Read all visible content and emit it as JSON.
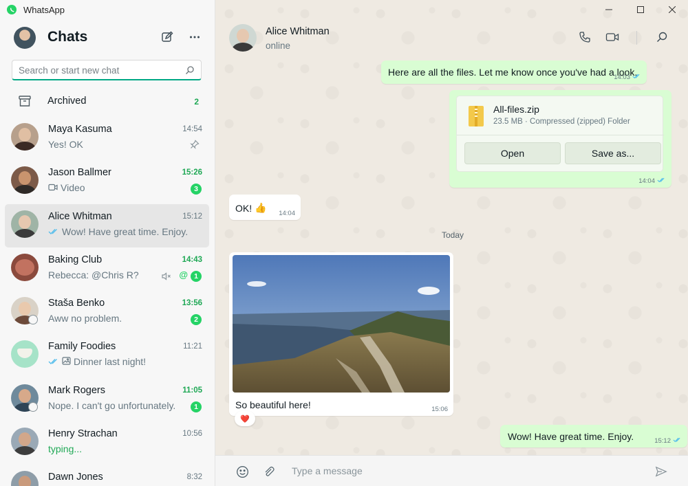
{
  "app": {
    "title": "WhatsApp"
  },
  "sidebar": {
    "title": "Chats",
    "search": {
      "placeholder": "Search or start new chat",
      "value": ""
    },
    "archived": {
      "label": "Archived",
      "count": "2"
    },
    "chats": [
      {
        "name": "Maya Kasuma",
        "time": "14:54",
        "preview": "Yes! OK",
        "pinned": true
      },
      {
        "name": "Jason Ballmer",
        "time": "15:26",
        "preview": "Video",
        "unread": "3"
      },
      {
        "name": "Alice Whitman",
        "time": "15:12",
        "preview": "Wow! Have great time. Enjoy."
      },
      {
        "name": "Baking Club",
        "time": "14:43",
        "preview": "Rebecca: @Chris R?",
        "unread": "1",
        "muted": true,
        "mention": "@"
      },
      {
        "name": "Staša Benko",
        "time": "13:56",
        "preview": "Aww no problem.",
        "unread": "2"
      },
      {
        "name": "Family Foodies",
        "time": "11:21",
        "preview": "Dinner last night!"
      },
      {
        "name": "Mark Rogers",
        "time": "11:05",
        "preview": "Nope. I can't go unfortunately.",
        "unread": "1"
      },
      {
        "name": "Henry Strachan",
        "time": "10:56",
        "preview": "typing..."
      },
      {
        "name": "Dawn Jones",
        "time": "8:32",
        "preview": ""
      }
    ]
  },
  "conversation": {
    "contact": {
      "name": "Alice Whitman",
      "status": "online"
    },
    "messages": {
      "files_text": {
        "text": "Here are all the files. Let me know once you've had a look.",
        "time": "14:03"
      },
      "file": {
        "name": "All-files.zip",
        "meta": "23.5 MB · Compressed (zipped) Folder",
        "open_label": "Open",
        "save_label": "Save as...",
        "time": "14:04"
      },
      "ok": {
        "text": "OK!",
        "emoji": "👍",
        "time": "14:04"
      },
      "date_chip": "Today",
      "photo": {
        "caption": "So beautiful here!",
        "time": "15:06",
        "reaction": "❤️"
      },
      "last": {
        "text": "Wow! Have great time. Enjoy.",
        "time": "15:12"
      }
    },
    "composer": {
      "placeholder": "Type a message",
      "value": ""
    }
  },
  "colors": {
    "accent": "#00a884",
    "unread_badge": "#25d366",
    "outgoing_bubble": "#d9fdd3",
    "read_tick": "#53bdeb"
  },
  "icons": [
    "whatsapp-logo-icon",
    "compose-icon",
    "more-options-icon",
    "search-icon",
    "archive-icon",
    "pin-icon",
    "video-icon",
    "double-check-icon",
    "mute-icon",
    "photo-icon",
    "phone-icon",
    "video-call-icon",
    "zip-file-icon",
    "emoji-icon",
    "attach-icon",
    "send-icon",
    "minimize-icon",
    "maximize-icon",
    "close-icon"
  ]
}
